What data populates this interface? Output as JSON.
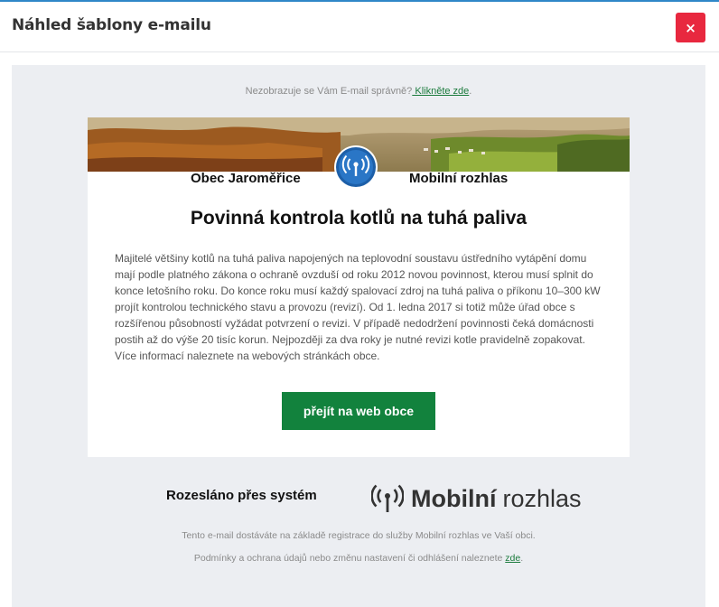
{
  "modal": {
    "title": "Náhled šablony e-mailu",
    "close_label": "×"
  },
  "email": {
    "notice_text": "Nezobrazuje se Vám E-mail správně?",
    "notice_link": " Klikněte zde",
    "notice_suffix": ".",
    "banner_image": "landscape-photo",
    "municipality": "Obec Jaroměřice",
    "brand": "Mobilní rozhlas",
    "headline": "Povinná kontrola kotlů na tuhá paliva",
    "body": "Majitelé většiny kotlů na tuhá paliva napojených na teplovodní soustavu ústředního vytápění domu mají podle platného zákona o ochraně ovzduší od roku 2012 novou povinnost, kterou musí splnit do konce letošního roku. Do konce roku musí každý spalovací zdroj na tuhá paliva o příkonu 10–300 kW projít kontrolou technického stavu a provozu (revizí). Od 1. ledna 2017 si totiž může úřad obce s rozšířenou působností vyžádat potvrzení o revizi. V případě nedodržení povinnosti čeká domácnosti postih až do výše 20 tisíc korun. Nejpozději za dva roky je nutné revizi kotle pravidelně zopakovat. Více informací naleznete na webových stránkách obce.",
    "cta_label": "přejít na web obce",
    "sent_via": "Rozesláno přes systém",
    "footer_logo_bold": "Mobilní",
    "footer_logo_light": "rozhlas",
    "footer_line1": "Tento e-mail dostáváte na základě registrace do služby Mobilní rozhlas ve Vaší obci.",
    "footer_line2": "Podmínky a ochrana údajů nebo změnu nastavení či odhlášení naleznete ",
    "footer_link": "zde",
    "footer_suffix": "."
  },
  "colors": {
    "accent_blue": "#2f87c8",
    "close_red": "#e8283f",
    "cta_green": "#12823d",
    "link_green": "#1a7a3c",
    "preview_bg": "#eceef2"
  }
}
